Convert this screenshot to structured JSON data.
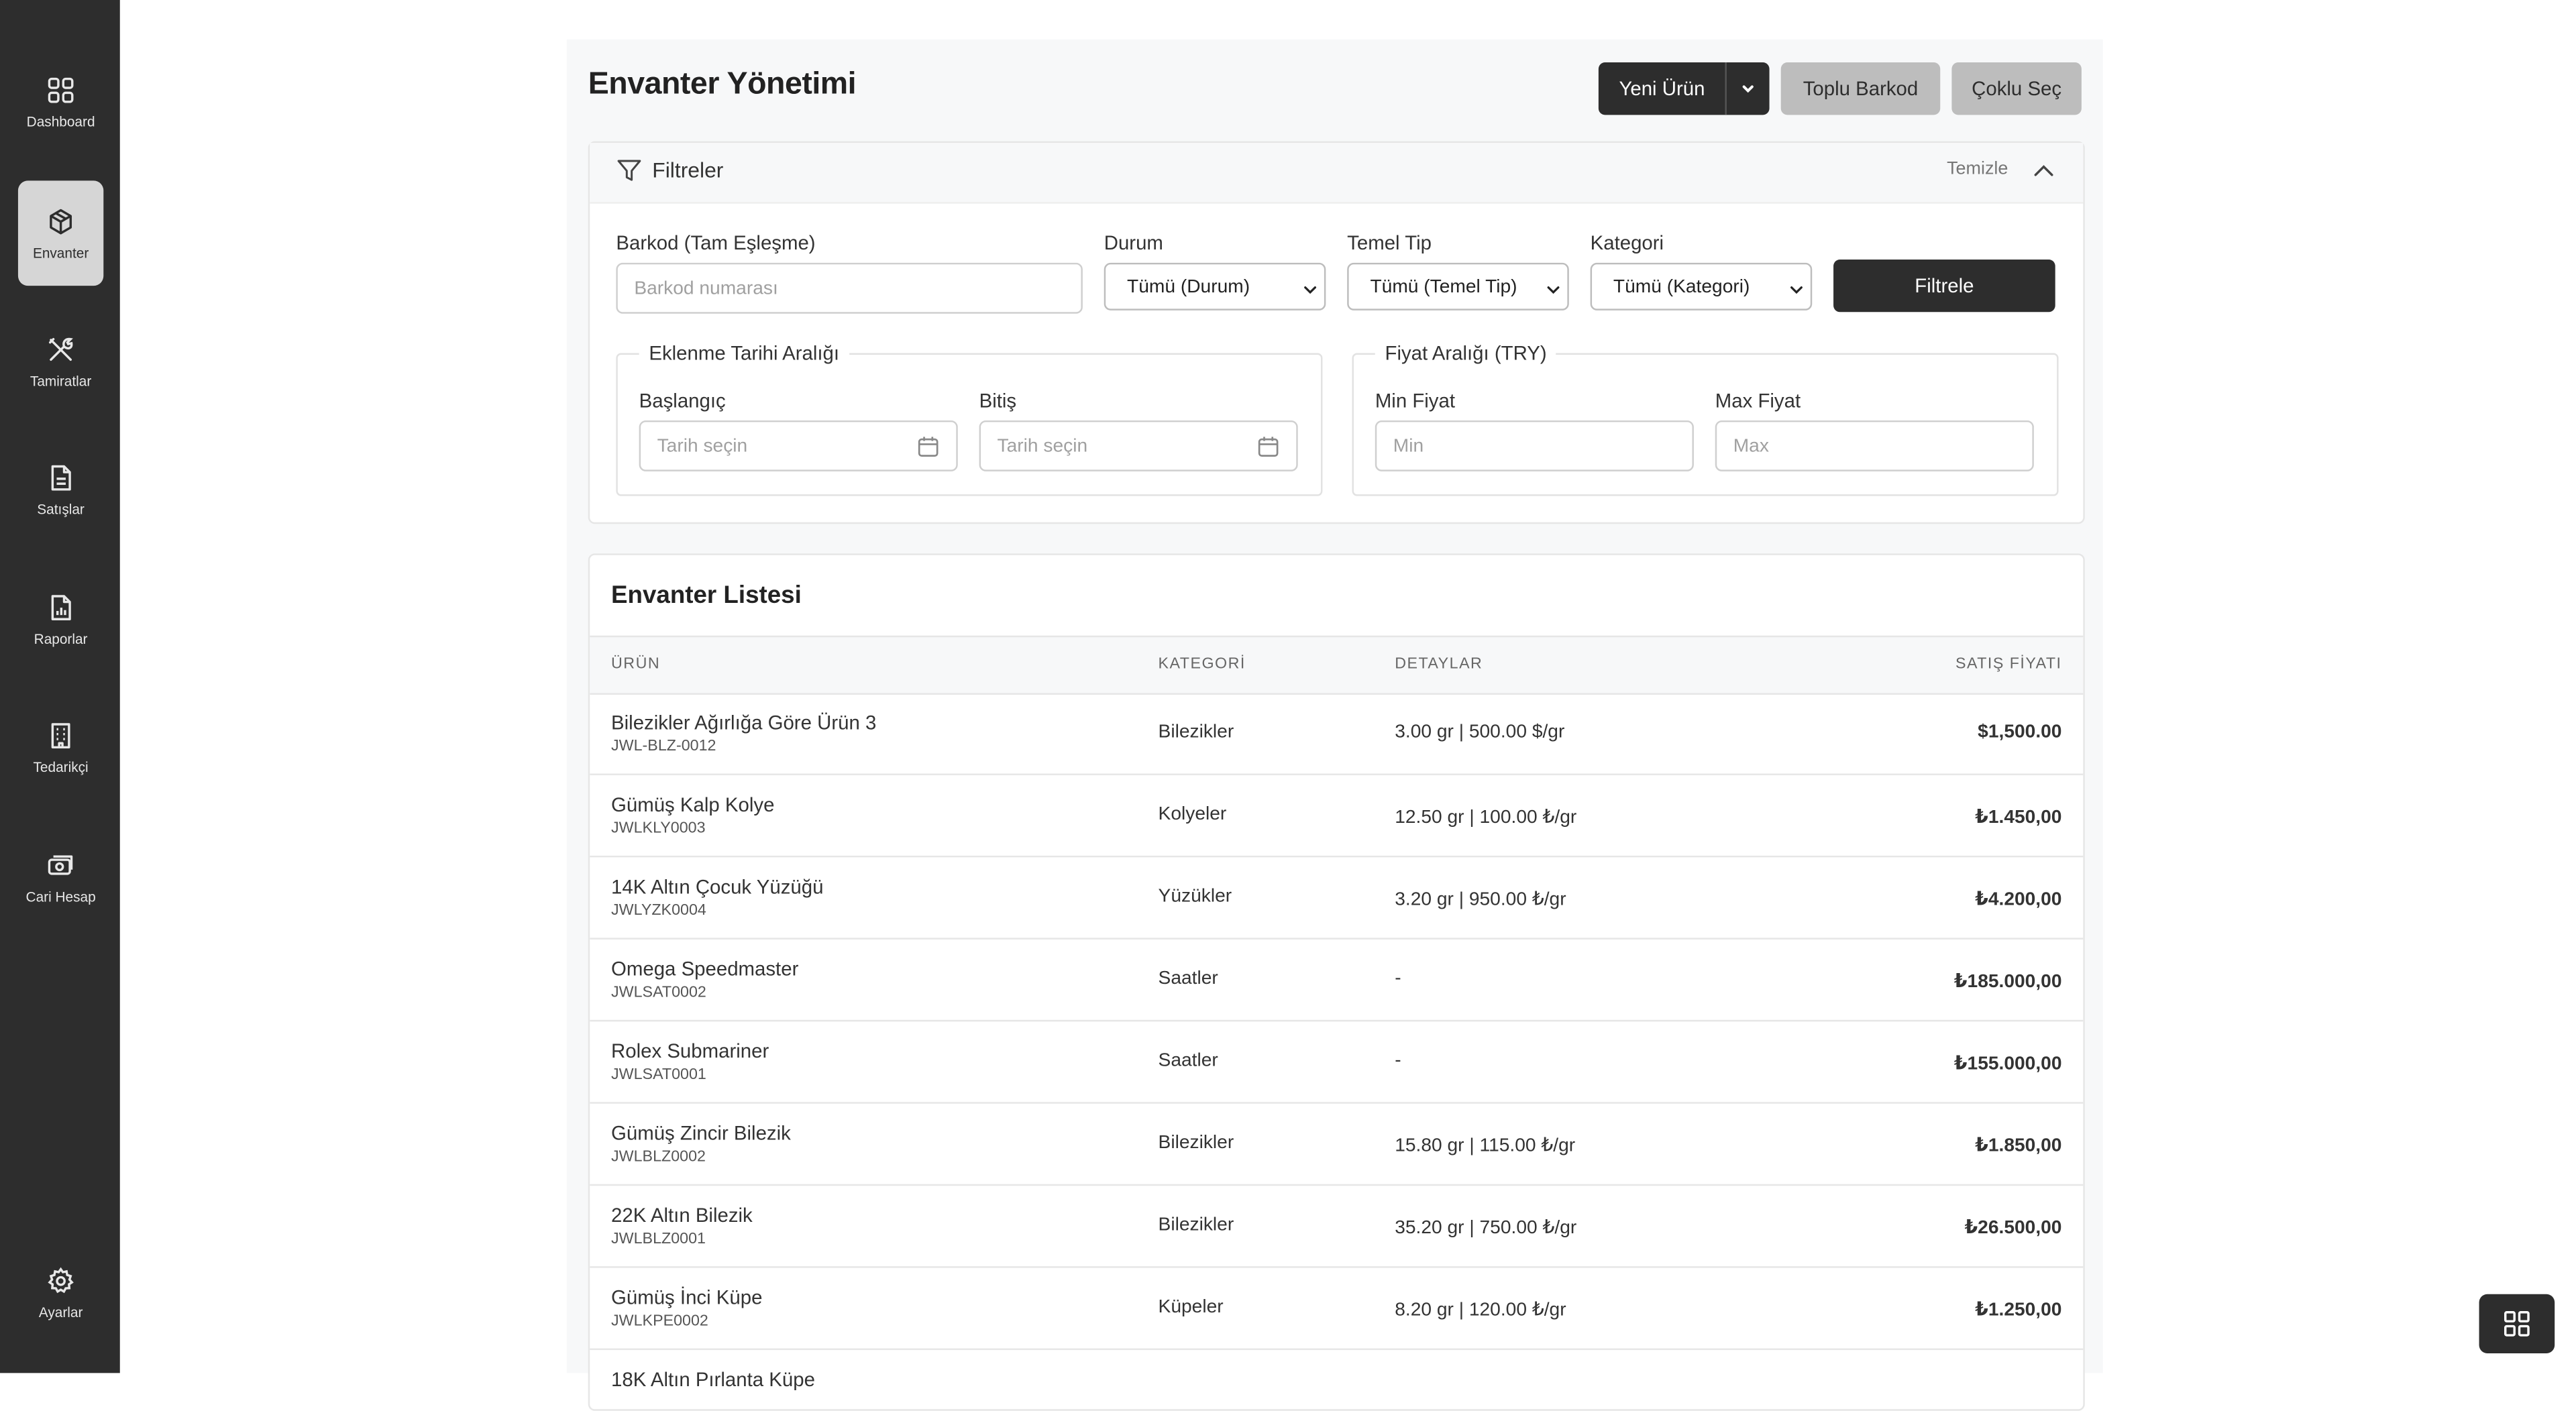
{
  "sidebar": {
    "items": [
      {
        "label": "Dashboard",
        "icon": "grid-icon"
      },
      {
        "label": "Envanter",
        "icon": "box-icon",
        "active": true
      },
      {
        "label": "Tamiratlar",
        "icon": "tools-icon"
      },
      {
        "label": "Satışlar",
        "icon": "document-icon"
      },
      {
        "label": "Raporlar",
        "icon": "report-icon"
      },
      {
        "label": "Tedarikçi",
        "icon": "building-icon"
      },
      {
        "label": "Cari Hesap",
        "icon": "money-icon"
      }
    ],
    "settings_label": "Ayarlar"
  },
  "header": {
    "title": "Envanter Yönetimi",
    "new_product": "Yeni Ürün",
    "bulk_barcode": "Toplu Barkod",
    "multi_select": "Çoklu Seç"
  },
  "filters": {
    "title": "Filtreler",
    "clear": "Temizle",
    "barcode_label": "Barkod (Tam Eşleşme)",
    "barcode_placeholder": "Barkod numarası",
    "status_label": "Durum",
    "status_value": "Tümü (Durum)",
    "base_type_label": "Temel Tip",
    "base_type_value": "Tümü (Temel Tip)",
    "category_label": "Kategori",
    "category_value": "Tümü (Kategori)",
    "filter_button": "Filtrele",
    "date_range_legend": "Eklenme Tarihi Aralığı",
    "start_label": "Başlangıç",
    "end_label": "Bitiş",
    "date_placeholder": "Tarih seçin",
    "price_range_legend": "Fiyat Aralığı (TRY)",
    "min_label": "Min Fiyat",
    "min_placeholder": "Min",
    "max_label": "Max Fiyat",
    "max_placeholder": "Max"
  },
  "inventory": {
    "title": "Envanter Listesi",
    "columns": [
      "ÜRÜN",
      "KATEGORİ",
      "DETAYLAR",
      "SATIŞ FİYATI"
    ],
    "rows": [
      {
        "name": "Bilezikler Ağırlığa Göre Ürün 3",
        "code": "JWL-BLZ-0012",
        "category": "Bilezikler",
        "details": "3.00 gr | 500.00 $/gr",
        "price": "$1,500.00"
      },
      {
        "name": "Gümüş Kalp Kolye",
        "code": "JWLKLY0003",
        "category": "Kolyeler",
        "details": "12.50 gr | 100.00 ₺/gr",
        "price": "₺1.450,00"
      },
      {
        "name": "14K Altın Çocuk Yüzüğü",
        "code": "JWLYZK0004",
        "category": "Yüzükler",
        "details": "3.20 gr | 950.00 ₺/gr",
        "price": "₺4.200,00"
      },
      {
        "name": "Omega Speedmaster",
        "code": "JWLSAT0002",
        "category": "Saatler",
        "details": "-",
        "price": "₺185.000,00"
      },
      {
        "name": "Rolex Submariner",
        "code": "JWLSAT0001",
        "category": "Saatler",
        "details": "-",
        "price": "₺155.000,00"
      },
      {
        "name": "Gümüş Zincir Bilezik",
        "code": "JWLBLZ0002",
        "category": "Bilezikler",
        "details": "15.80 gr | 115.00 ₺/gr",
        "price": "₺1.850,00"
      },
      {
        "name": "22K Altın Bilezik",
        "code": "JWLBLZ0001",
        "category": "Bilezikler",
        "details": "35.20 gr | 750.00 ₺/gr",
        "price": "₺26.500,00"
      },
      {
        "name": "Gümüş İnci Küpe",
        "code": "JWLKPE0002",
        "category": "Küpeler",
        "details": "8.20 gr | 120.00 ₺/gr",
        "price": "₺1.250,00"
      },
      {
        "name": "18K Altın Pırlanta Küpe",
        "code": "",
        "category": "",
        "details": "",
        "price": ""
      }
    ]
  }
}
